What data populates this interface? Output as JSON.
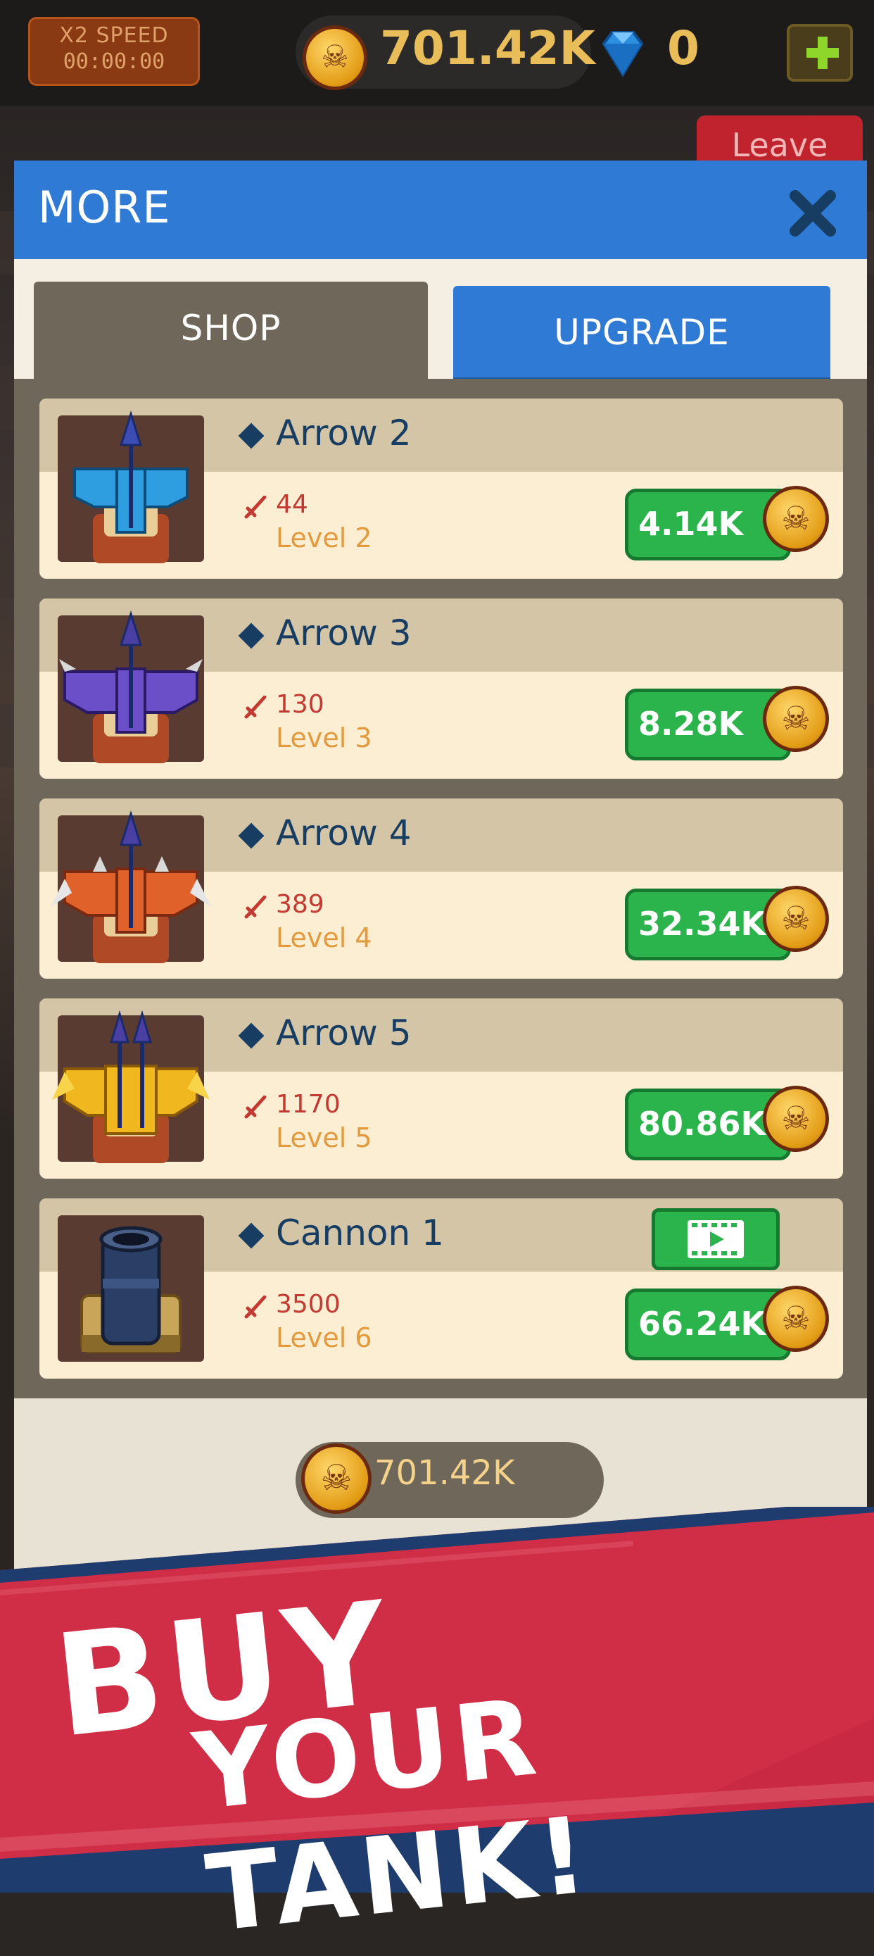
{
  "hud": {
    "speed_label": "X2 SPEED",
    "speed_timer": "00:00:00",
    "gold": "701.42K",
    "gems": "0",
    "leave_label": "Leave"
  },
  "modal": {
    "title": "MORE",
    "tabs": [
      {
        "label": "SHOP",
        "active": false
      },
      {
        "label": "UPGRADE",
        "active": true
      }
    ],
    "items": [
      {
        "name": "Arrow 2",
        "power": "44",
        "level": "Level 2",
        "price": "4.14K",
        "icon": "blue-arrow-tower-icon"
      },
      {
        "name": "Arrow 3",
        "power": "130",
        "level": "Level 3",
        "price": "8.28K",
        "icon": "purple-arrow-tower-icon"
      },
      {
        "name": "Arrow 4",
        "power": "389",
        "level": "Level 4",
        "price": "32.34K",
        "icon": "orange-arrow-tower-icon"
      },
      {
        "name": "Arrow 5",
        "power": "1170",
        "level": "Level 5",
        "price": "80.86K",
        "icon": "gold-double-arrow-tower-icon"
      },
      {
        "name": "Cannon 1",
        "power": "3500",
        "level": "Level 6",
        "price": "66.24K",
        "icon": "cannon-tower-icon",
        "video": true
      }
    ],
    "total_gold": "701.42K"
  },
  "promo": {
    "line1": "BUY",
    "line2": "YOUR TANK!"
  },
  "colors": {
    "header_blue": "#2f7ad4",
    "buy_green": "#2bb44c",
    "banner_red": "#d02d46",
    "gold": "#e9bd5a"
  }
}
